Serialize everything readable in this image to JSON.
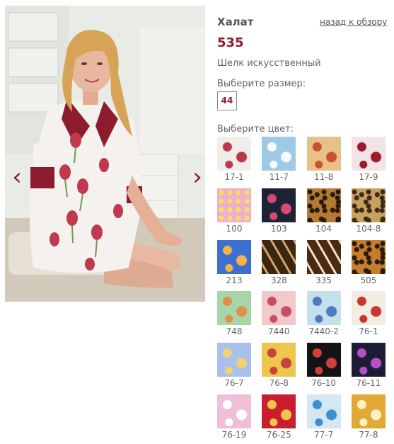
{
  "product": {
    "title": "Халат",
    "back_link": "назад к обзору",
    "article": "535",
    "material": "Шелк искусственный"
  },
  "size": {
    "label": "Выберите размер:",
    "options": [
      "44"
    ]
  },
  "colors": {
    "label": "Выберите цвет:",
    "items": [
      {
        "code": "17-1",
        "bg": "#f1eeea",
        "fg": "#b8394b",
        "style": "floral"
      },
      {
        "code": "11-7",
        "bg": "#9fc9e6",
        "fg": "#f7fbff",
        "style": "floral"
      },
      {
        "code": "11-8",
        "bg": "#e8c08a",
        "fg": "#c9542c",
        "style": "floral"
      },
      {
        "code": "17-9",
        "bg": "#f2e4e6",
        "fg": "#9c1c2d",
        "style": "floral"
      },
      {
        "code": "100",
        "bg": "#efb0cf",
        "fg": "#f7e05a",
        "style": "dots"
      },
      {
        "code": "103",
        "bg": "#1d2334",
        "fg": "#d44a74",
        "style": "floral"
      },
      {
        "code": "104",
        "bg": "#b57a36",
        "fg": "#2a1a0e",
        "style": "leopard"
      },
      {
        "code": "104-8",
        "bg": "#c9a15f",
        "fg": "#3a2a18",
        "style": "leopard"
      },
      {
        "code": "213",
        "bg": "#3c6fcf",
        "fg": "#f3b44a",
        "style": "floral"
      },
      {
        "code": "328",
        "bg": "#3b2614",
        "fg": "#d7a565",
        "style": "stripes"
      },
      {
        "code": "335",
        "bg": "#4c2a12",
        "fg": "#efe1c9",
        "style": "stripes"
      },
      {
        "code": "505",
        "bg": "#c47e2d",
        "fg": "#2b1a0c",
        "style": "leopard"
      },
      {
        "code": "748",
        "bg": "#a7d5a8",
        "fg": "#e48e4b",
        "style": "floral"
      },
      {
        "code": "7440",
        "bg": "#f1c9c9",
        "fg": "#c55061",
        "style": "floral"
      },
      {
        "code": "7440-2",
        "bg": "#c4e0ea",
        "fg": "#4f79bf",
        "style": "floral"
      },
      {
        "code": "76-1",
        "bg": "#f3ece3",
        "fg": "#c7362f",
        "style": "floral"
      },
      {
        "code": "76-7",
        "bg": "#a7c1ec",
        "fg": "#f0d36e",
        "style": "floral"
      },
      {
        "code": "76-8",
        "bg": "#efc64d",
        "fg": "#c4443e",
        "style": "floral"
      },
      {
        "code": "76-10",
        "bg": "#141414",
        "fg": "#d23d3d",
        "style": "floral"
      },
      {
        "code": "76-11",
        "bg": "#1b1c36",
        "fg": "#b94ec5",
        "style": "floral"
      },
      {
        "code": "76-19",
        "bg": "#f0bfd7",
        "fg": "#ffffff",
        "style": "floral"
      },
      {
        "code": "76-25",
        "bg": "#c81f2e",
        "fg": "#f3c64a",
        "style": "floral"
      },
      {
        "code": "77-7",
        "bg": "#d3e8f3",
        "fg": "#3c8fd1",
        "style": "floral"
      },
      {
        "code": "77-8",
        "bg": "#e0a936",
        "fg": "#fff1c2",
        "style": "floral"
      }
    ]
  },
  "gallery": {
    "prev_icon": "chevron-left-icon",
    "next_icon": "chevron-right-icon",
    "accent": "#8c1c2e"
  }
}
